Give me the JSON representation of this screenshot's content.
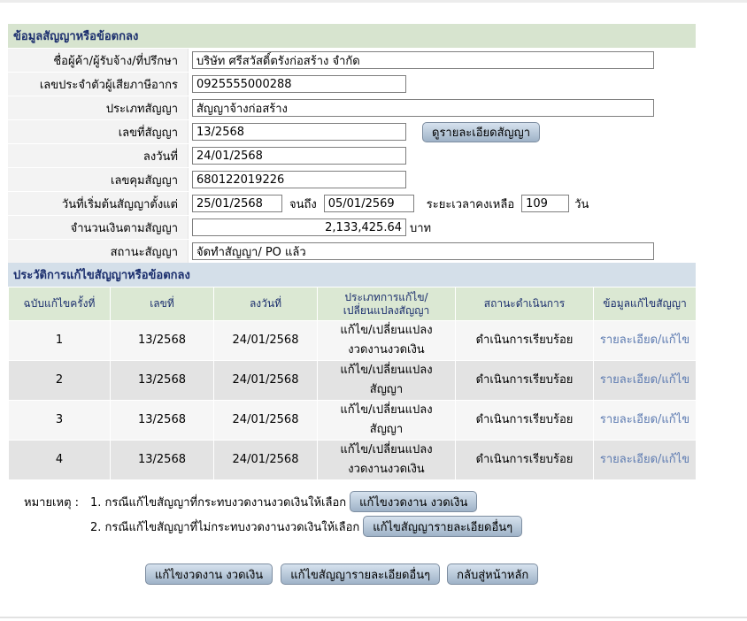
{
  "contract_section": {
    "title": "ข้อมูลสัญญาหรือข้อตกลง",
    "vendor_label": "ชื่อผู้ค้า/ผู้รับจ้าง/ที่ปรึกษา",
    "vendor_value": "บริษัท ศรีสวัสดิ์ตรังก่อสร้าง จำกัด",
    "taxid_label": "เลขประจำตัวผู้เสียภาษีอากร",
    "taxid_value": "0925555000288",
    "type_label": "ประเภทสัญญา",
    "type_value": "สัญญาจ้างก่อสร้าง",
    "number_label": "เลขที่สัญญา",
    "number_value": "13/2568",
    "detail_button": "ดูรายละเอียดสัญญา",
    "date_label": "ลงวันที่",
    "date_value": "24/01/2568",
    "control_label": "เลขคุมสัญญา",
    "control_value": "680122019226",
    "start_label": "วันที่เริ่มต้นสัญญาตั้งแต่",
    "start_value": "25/01/2568",
    "until_label": "จนถึง",
    "until_value": "05/01/2569",
    "remaining_label": "ระยะเวลาคงเหลือ",
    "remaining_value": "109",
    "days_unit": "วัน",
    "amount_label": "จำนวนเงินตามสัญญา",
    "amount_value": "2,133,425.64",
    "currency_unit": "บาท",
    "status_label": "สถานะสัญญา",
    "status_value": "จัดทำสัญญา/ PO แล้ว"
  },
  "history_section": {
    "title": "ประวัติการแก้ไขสัญญาหรือข้อตกลง",
    "headers": {
      "edition": "ฉบับแก้ไขครั้งที่",
      "number": "เลขที่",
      "date": "ลงวันที่",
      "type_line1": "ประเภทการแก้ไข/",
      "type_line2": "เปลี่ยนแปลงสัญญา",
      "status": "สถานะดำเนินการ",
      "info": "ข้อมูลแก้ไขสัญญา"
    },
    "rows": [
      {
        "edition": "1",
        "number": "13/2568",
        "date": "24/01/2568",
        "type_line1": "แก้ไข/เปลี่ยนแปลง",
        "type_line2": "งวดงานงวดเงิน",
        "status": "ดำเนินการเรียบร้อย",
        "link": "รายละเอียด/แก้ไข"
      },
      {
        "edition": "2",
        "number": "13/2568",
        "date": "24/01/2568",
        "type_line1": "แก้ไข/เปลี่ยนแปลง",
        "type_line2": "สัญญา",
        "status": "ดำเนินการเรียบร้อย",
        "link": "รายละเอียด/แก้ไข"
      },
      {
        "edition": "3",
        "number": "13/2568",
        "date": "24/01/2568",
        "type_line1": "แก้ไข/เปลี่ยนแปลง",
        "type_line2": "สัญญา",
        "status": "ดำเนินการเรียบร้อย",
        "link": "รายละเอียด/แก้ไข"
      },
      {
        "edition": "4",
        "number": "13/2568",
        "date": "24/01/2568",
        "type_line1": "แก้ไข/เปลี่ยนแปลง",
        "type_line2": "งวดงานงวดเงิน",
        "status": "ดำเนินการเรียบร้อย",
        "link": "รายละเอียด/แก้ไข"
      }
    ]
  },
  "notes": {
    "label": "หมายเหตุ :",
    "note1_text": "1. กรณีแก้ไขสัญญาที่กระทบงวดงานงวดเงินให้เลือก",
    "note1_button": "แก้ไขงวดงาน งวดเงิน",
    "note2_text": "2. กรณีแก้ไขสัญญาที่ไม่กระทบงวดงานงวดเงินให้เลือก",
    "note2_button": "แก้ไขสัญญารายละเอียดอื่นๆ"
  },
  "footer": {
    "edit_installment_button": "แก้ไขงวดงาน งวดเงิน",
    "edit_other_button": "แก้ไขสัญญารายละเอียดอื่นๆ",
    "back_button": "กลับสู่หน้าหลัก"
  }
}
